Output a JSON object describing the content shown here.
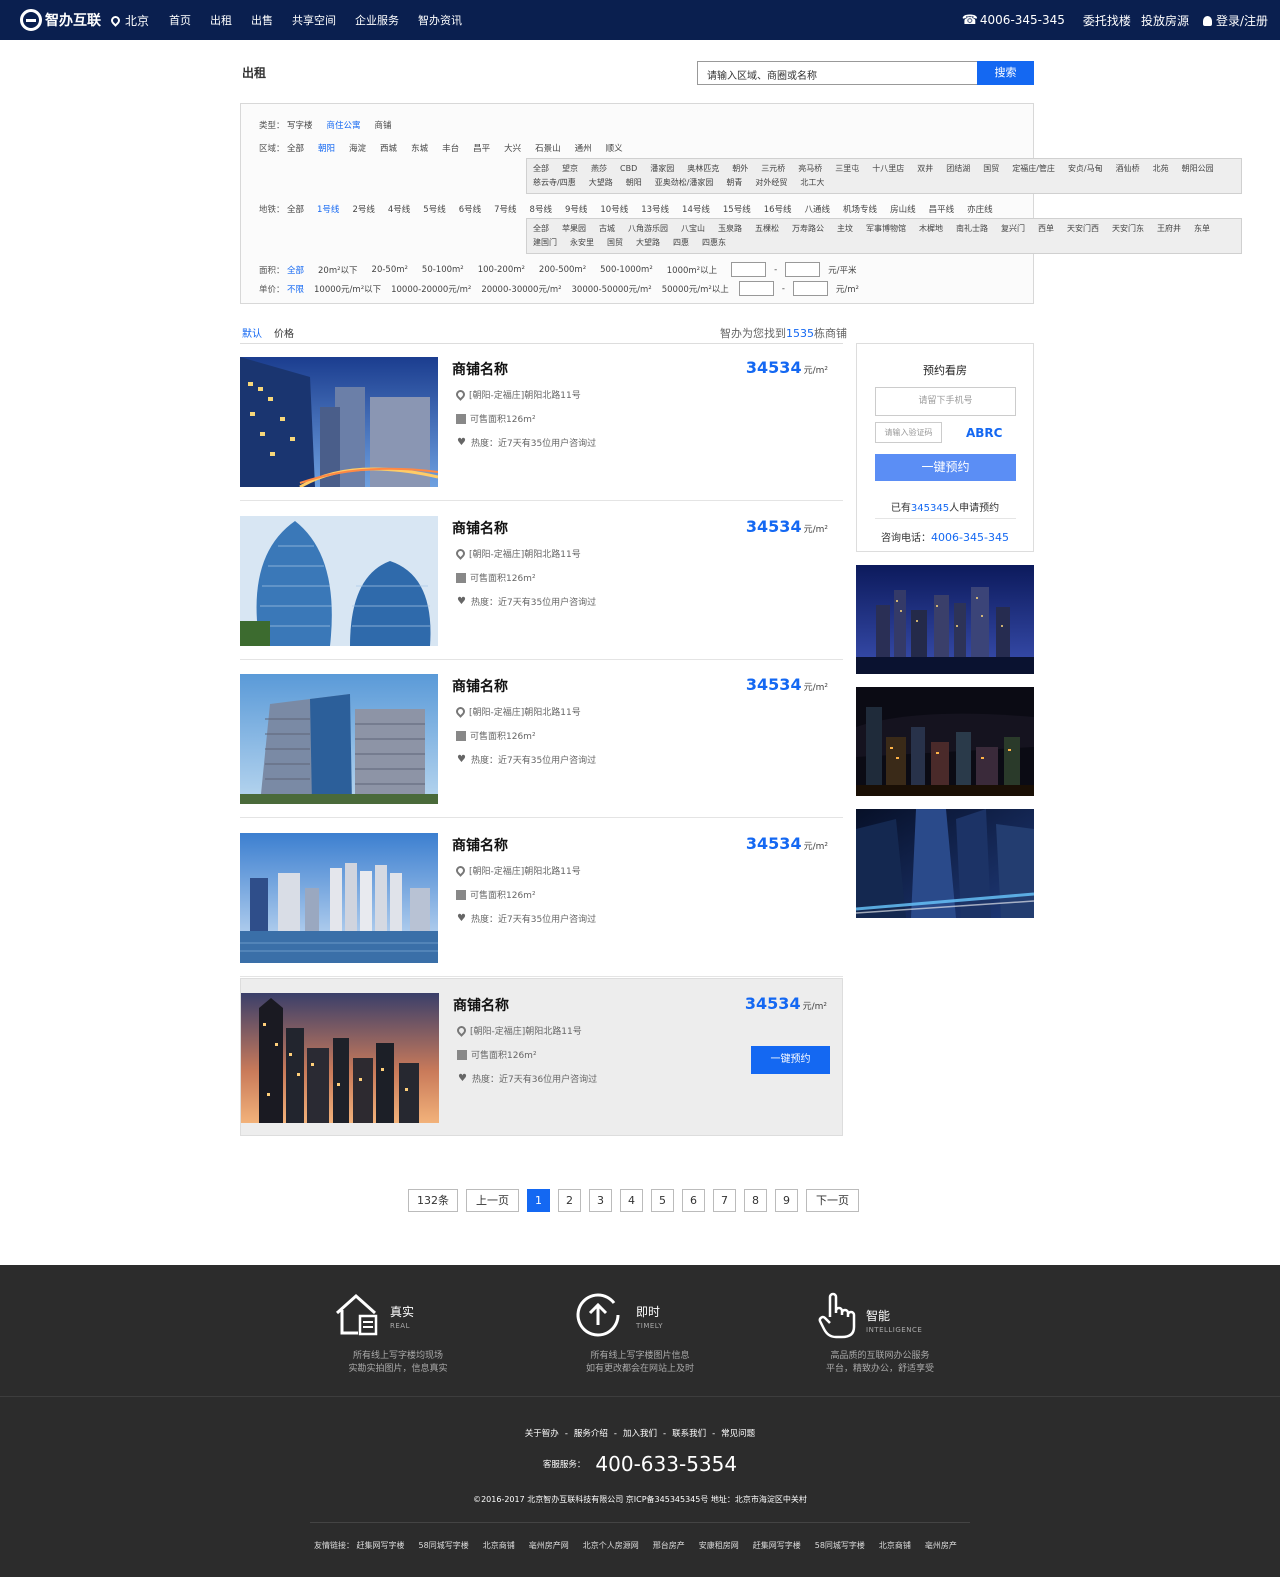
{
  "header": {
    "brand": "智办互联",
    "city": "北京",
    "nav": [
      "首页",
      "出租",
      "出售",
      "共享空间",
      "企业服务",
      "智办资讯"
    ],
    "phone": "4006-345-345",
    "links": [
      "委托找楼",
      "投放房源"
    ],
    "login": "登录/注册"
  },
  "page": {
    "breadcrumb": "出租",
    "search_placeholder": "请输入区域、商圈或名称",
    "search_button": "搜索"
  },
  "filter": {
    "type": {
      "label": "类型：",
      "options": [
        "写字楼",
        "商住公寓",
        "商铺"
      ],
      "active": "商住公寓"
    },
    "area": {
      "label": "区域：",
      "options": [
        "全部",
        "朝阳",
        "海淀",
        "西城",
        "东城",
        "丰台",
        "昌平",
        "大兴",
        "石景山",
        "通州",
        "顺义"
      ],
      "active": "朝阳"
    },
    "area_sub": [
      "全部",
      "望京",
      "燕莎",
      "CBD",
      "潘家园",
      "奥林匹克",
      "朝外",
      "三元桥",
      "亮马桥",
      "三里屯",
      "十八里店",
      "双井",
      "团结湖",
      "国贸",
      "定福庄/管庄",
      "安贞/马甸",
      "酒仙桥",
      "北苑",
      "朝阳公园",
      "慈云寺/四惠",
      "大望路",
      "朝阳",
      "亚奥劲松/潘家园",
      "朝青",
      "对外经贸",
      "北工大"
    ],
    "metro": {
      "label": "地铁：",
      "options": [
        "全部",
        "1号线",
        "2号线",
        "4号线",
        "5号线",
        "6号线",
        "7号线",
        "8号线",
        "9号线",
        "10号线",
        "13号线",
        "14号线",
        "15号线",
        "16号线",
        "八通线",
        "机场专线",
        "房山线",
        "昌平线",
        "亦庄线"
      ],
      "active": "1号线"
    },
    "metro_sub": [
      "全部",
      "苹果园",
      "古城",
      "八角游乐园",
      "八宝山",
      "玉泉路",
      "五棵松",
      "万寿路公",
      "主坟",
      "军事博物馆",
      "木樨地",
      "南礼士路",
      "复兴门",
      "西单",
      "天安门西",
      "天安门东",
      "王府井",
      "东单",
      "建国门",
      "永安里",
      "国贸",
      "大望路",
      "四惠",
      "四惠东"
    ],
    "size": {
      "label": "面积：",
      "options": [
        "全部",
        "20m²以下",
        "20-50m²",
        "50-100m²",
        "100-200m²",
        "200-500m²",
        "500-1000m²",
        "1000m²以上"
      ],
      "active": "全部",
      "dash": "-",
      "unit": "元/平米"
    },
    "price": {
      "label": "单价：",
      "options": [
        "不限",
        "10000元/m²以下",
        "10000-20000元/m²",
        "20000-30000元/m²",
        "30000-50000元/m²",
        "50000元/m²以上"
      ],
      "active": "不限",
      "dash": "-",
      "unit": "元/m²"
    }
  },
  "sort": {
    "tabs": [
      "默认",
      "价格"
    ],
    "active": "默认"
  },
  "result": {
    "prefix": "智办为您找到",
    "count": "1535",
    "suffix": "栋商铺"
  },
  "listings": [
    {
      "name": "商铺名称",
      "address": "[朝阳-定福庄]朝阳北路11号",
      "size": "可售面积126m²",
      "heat": "热度：近7天有35位用户咨询过",
      "price": "34534",
      "unit": "元/m²"
    },
    {
      "name": "商铺名称",
      "address": "[朝阳-定福庄]朝阳北路11号",
      "size": "可售面积126m²",
      "heat": "热度：近7天有35位用户咨询过",
      "price": "34534",
      "unit": "元/m²"
    },
    {
      "name": "商铺名称",
      "address": "[朝阳-定福庄]朝阳北路11号",
      "size": "可售面积126m²",
      "heat": "热度：近7天有35位用户咨询过",
      "price": "34534",
      "unit": "元/m²"
    },
    {
      "name": "商铺名称",
      "address": "[朝阳-定福庄]朝阳北路11号",
      "size": "可售面积126m²",
      "heat": "热度：近7天有35位用户咨询过",
      "price": "34534",
      "unit": "元/m²"
    },
    {
      "name": "商铺名称",
      "address": "[朝阳-定福庄]朝阳北路11号",
      "size": "可售面积126m²",
      "heat": "热度：近7天有36位用户咨询过",
      "price": "34534",
      "unit": "元/m²",
      "button": "一键预约"
    }
  ],
  "booking": {
    "title": "预约看房",
    "phone_placeholder": "请留下手机号",
    "code_placeholder": "请输入验证码",
    "captcha": "ABRC",
    "button": "一键预约",
    "count_prefix": "已有",
    "count": "345345",
    "count_suffix": "人申请预约",
    "tel_label": "咨询电话：",
    "tel": "4006-345-345"
  },
  "pagination": {
    "total": "132条",
    "prev": "上一页",
    "pages": [
      "1",
      "2",
      "3",
      "4",
      "5",
      "6",
      "7",
      "8",
      "9"
    ],
    "active": "1",
    "next": "下一页"
  },
  "footer": {
    "features": [
      {
        "title": "真实",
        "en": "REAL",
        "desc1": "所有线上写字楼均现场",
        "desc2": "实勘实拍图片，信息真实"
      },
      {
        "title": "即时",
        "en": "TIMELY",
        "desc1": "所有线上写字楼图片信息",
        "desc2": "如有更改都会在网站上及时"
      },
      {
        "title": "智能",
        "en": "INTELLIGENCE",
        "desc1": "高品质的互联网办公服务",
        "desc2": "平台，精致办公，舒适享受"
      }
    ],
    "links": [
      "关于智办",
      "服务介绍",
      "加入我们",
      "联系我们",
      "常见问题"
    ],
    "link_sep": "-",
    "service_label": "客服服务：",
    "service_phone": "400-633-5354",
    "copyright": "©2016-2017 北京智办互联科技有限公司 京ICP备345345345号    地址：北京市海淀区中关村",
    "friends_label": "友情链接：",
    "friends": [
      "赶集网写字楼",
      "58同城写字楼",
      "北京商铺",
      "亳州房产网",
      "北京个人房源网",
      "邢台房产",
      "安康租房网",
      "赶集网写字楼",
      "58同城写字楼",
      "北京商铺",
      "亳州房产"
    ]
  },
  "colors": {
    "nav_bg": "#0a1f4f",
    "accent": "#1468f2",
    "footer_bg": "#2c2c2c"
  }
}
